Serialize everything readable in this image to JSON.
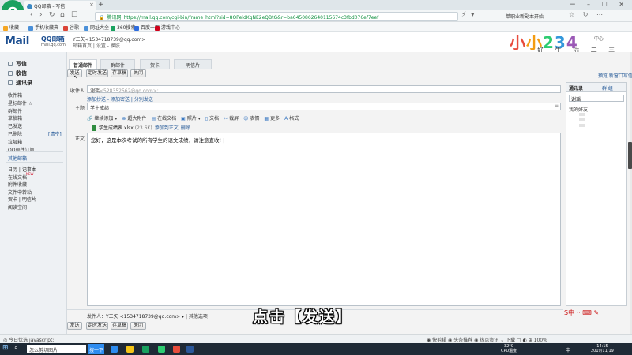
{
  "browser": {
    "tab_title": "QQ邮箱 - 写信",
    "tab_close": "×",
    "new_tab": "+",
    "url_badge": "腾讯网",
    "url": "https://mail.qq.com/cgi-bin/frame_html?sid=8OPeldKqNE2eQBtG&r=ba6450862640115674c3fbd076ef7eef",
    "search_hint": "单职业新副本开始",
    "window_controls": "☰ – ☐ ✕",
    "nav_icons": "☆ ↻ ⋯",
    "bookmarks": [
      {
        "label": "收藏",
        "color": "#f5a623"
      },
      {
        "label": "手机收藏夹",
        "color": "#4a90d9"
      },
      {
        "label": "谷歌",
        "color": "#db4437"
      },
      {
        "label": "网址大全",
        "color": "#4a90d9"
      },
      {
        "label": "360搜索",
        "color": "#19a15f"
      },
      {
        "label": "百度一下",
        "color": "#2d6cdf"
      },
      {
        "label": "游戏中心",
        "color": "#d0021b"
      }
    ]
  },
  "mail_header": {
    "logo": "Mail",
    "logo_sub": "QQ邮箱",
    "logo_domain": "mail.qq.com",
    "user_line": "Y三矢<1534718739@qq.com>",
    "user_links": "邮箱首页 | 设置 - 换肤",
    "skin_link": "中心"
  },
  "watermark": {
    "chars": [
      "小",
      "小",
      "2",
      "3",
      "4"
    ],
    "colors": [
      "#e84c3d",
      "#f39c12",
      "#2ecc71",
      "#3498db",
      "#9b59b6"
    ],
    "sub": "好 生 活 二 三 四"
  },
  "sidebar": {
    "main": [
      {
        "label": "写信"
      },
      {
        "label": "收信"
      },
      {
        "label": "通讯录"
      }
    ],
    "items": [
      "收件箱",
      "星标邮件 ☆",
      "群邮件",
      "草稿箱",
      "已发送",
      "已删除",
      "垃圾箱",
      "QQ邮件订阅"
    ],
    "clear_label": "[清空]",
    "other_label": "其他邮箱",
    "extras": [
      "日历 | 记事本",
      "在线文档",
      "附件收藏",
      "文件中转站",
      "贺卡 | 明信片",
      "阅读空间"
    ],
    "new_tag": "NEW"
  },
  "compose": {
    "tabs": [
      "普通邮件",
      "群邮件",
      "贺卡",
      "明信片"
    ],
    "toolbar": {
      "send": "发送",
      "timed_send": "定时发送",
      "save_draft": "存草稿",
      "close": "关闭"
    },
    "right_links": "预览   新窗口写信",
    "to_label": "收件人",
    "to_name": "谢瑶",
    "to_email": "<528352562@qq.com>;",
    "to_links": "添加抄送 - 添加密送 | 分别发送",
    "subject_label": "主题",
    "subject_value": "学生成绩",
    "subject_arrow": "≡",
    "attach_tools": [
      {
        "icon": "🔗",
        "label": "继续添加 ▾"
      },
      {
        "icon": "⊕",
        "label": "超大附件"
      },
      {
        "icon": "▤",
        "label": "在线文档"
      },
      {
        "icon": "▣",
        "label": "照片 ▾"
      },
      {
        "icon": "▯",
        "label": "文档"
      },
      {
        "icon": "✂",
        "label": "截屏"
      },
      {
        "icon": "☺",
        "label": "表情"
      },
      {
        "icon": "▦",
        "label": "更多"
      },
      {
        "icon": "A",
        "label": "格式"
      }
    ],
    "attachment_name": "学生成绩表.xlsx",
    "attachment_size": "(23.6K)",
    "attachment_actions": [
      "添加到正文",
      "删除"
    ],
    "body_label": "正文",
    "body_text": "您好，这是本次考试的所有学生的语文成绩，请注意查收! |",
    "sender_label": "发件人：",
    "sender_value": "Y三矢 <1534718739@qq.com> ▾",
    "other_options": "其他选项"
  },
  "address_panel": {
    "tab1": "通讯录",
    "tab2": "群 组",
    "search_value": "谢瑶",
    "friend_label": "我的好友"
  },
  "caption": "点击【发送】",
  "status": {
    "left": "◎ 今日优选   javascript:;",
    "right": "◉ 快剪辑    ◉ 头条推荐    ◉ 热点资讯    ↓ 下载    ▢    ◐    ⊕ 100%"
  },
  "ime_text": "S中 ·· ⌨ ✎",
  "taskbar": {
    "search_text": "怎么剪切图片",
    "app_label": "搜一下",
    "temp": "32°C\nCPU温度",
    "lang": "中",
    "clock_time": "14:15",
    "clock_date": "2019/11/19",
    "icons": [
      {
        "name": "edge-icon",
        "color": "#2d8cf0"
      },
      {
        "name": "explorer-icon",
        "color": "#f5c518"
      },
      {
        "name": "browser-360-icon",
        "color": "#19a15f"
      },
      {
        "name": "wechat-icon",
        "color": "#2ecc71"
      },
      {
        "name": "recorder-icon",
        "color": "#e74c3c"
      },
      {
        "name": "word-icon",
        "color": "#2b579a"
      }
    ]
  }
}
